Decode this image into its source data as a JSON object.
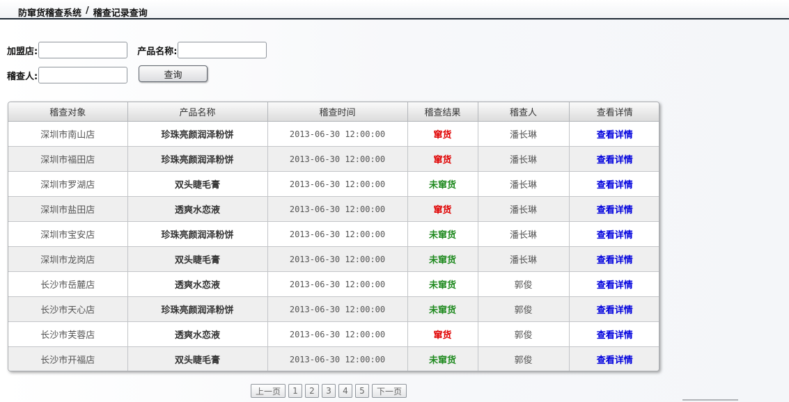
{
  "breadcrumb": {
    "system": "防窜货稽查系统",
    "separator": "/",
    "page": "稽查记录查询"
  },
  "search": {
    "store_label": "加盟店:",
    "store_value": "",
    "product_label": "产品名称:",
    "product_value": "",
    "inspector_label": "稽查人:",
    "inspector_value": "",
    "query_button": "查询"
  },
  "table": {
    "headers": [
      "稽查对象",
      "产品名称",
      "稽查时间",
      "稽查结果",
      "稽查人",
      "查看详情"
    ],
    "rows": [
      {
        "store": "深圳市南山店",
        "product": "珍珠亮颜润泽粉饼",
        "time": "2013-06-30 12:00:00",
        "result": "窜货",
        "inspector": "潘长琳",
        "detail": "查看详情"
      },
      {
        "store": "深圳市福田店",
        "product": "珍珠亮颜润泽粉饼",
        "time": "2013-06-30 12:00:00",
        "result": "窜货",
        "inspector": "潘长琳",
        "detail": "查看详情"
      },
      {
        "store": "深圳市罗湖店",
        "product": "双头睫毛膏",
        "time": "2013-06-30 12:00:00",
        "result": "未窜货",
        "inspector": "潘长琳",
        "detail": "查看详情"
      },
      {
        "store": "深圳市盐田店",
        "product": "透爽水恋液",
        "time": "2013-06-30 12:00:00",
        "result": "窜货",
        "inspector": "潘长琳",
        "detail": "查看详情"
      },
      {
        "store": "深圳市宝安店",
        "product": "珍珠亮颜润泽粉饼",
        "time": "2013-06-30 12:00:00",
        "result": "未窜货",
        "inspector": "潘长琳",
        "detail": "查看详情"
      },
      {
        "store": "深圳市龙岗店",
        "product": "双头睫毛膏",
        "time": "2013-06-30 12:00:00",
        "result": "未窜货",
        "inspector": "潘长琳",
        "detail": "查看详情"
      },
      {
        "store": "长沙市岳麓店",
        "product": "透爽水恋液",
        "time": "2013-06-30 12:00:00",
        "result": "未窜货",
        "inspector": "郭俊",
        "detail": "查看详情"
      },
      {
        "store": "长沙市天心店",
        "product": "珍珠亮颜润泽粉饼",
        "time": "2013-06-30 12:00:00",
        "result": "未窜货",
        "inspector": "郭俊",
        "detail": "查看详情"
      },
      {
        "store": "长沙市芙蓉店",
        "product": "透爽水恋液",
        "time": "2013-06-30 12:00:00",
        "result": "窜货",
        "inspector": "郭俊",
        "detail": "查看详情"
      },
      {
        "store": "长沙市开福店",
        "product": "双头睫毛膏",
        "time": "2013-06-30 12:00:00",
        "result": "未窜货",
        "inspector": "郭俊",
        "detail": "查看详情"
      }
    ]
  },
  "pager": {
    "prev": "上一页",
    "pages": [
      "1",
      "2",
      "3",
      "4",
      "5"
    ],
    "next": "下一页"
  },
  "colors": {
    "result_bad": "#e00000",
    "result_good": "#1f8a1f",
    "detail_link": "#0000dd",
    "header_rule": "#1f2a36"
  }
}
